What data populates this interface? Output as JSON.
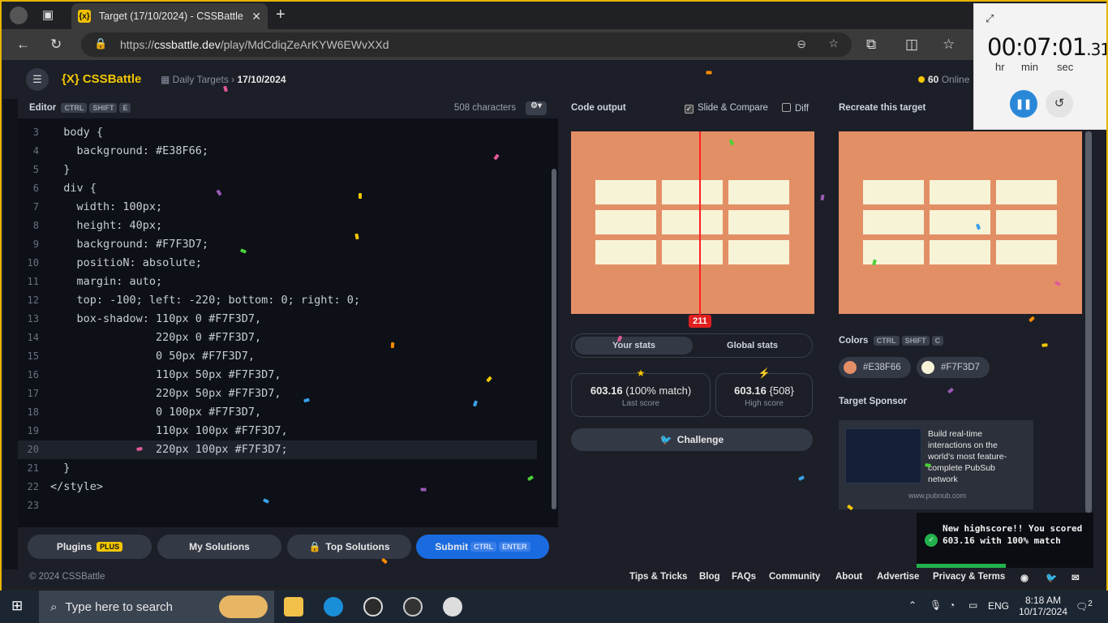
{
  "browser": {
    "tab_title": "Target (17/10/2024) - CSSBattle",
    "tab_favicon": "{x}",
    "url_prefix": "https://",
    "url_host": "cssbattle.dev",
    "url_path": "/play/MdCdiqZeArKYW6EWvXXd"
  },
  "header": {
    "logo": "{X} CSSBattle",
    "breadcrumb_parent": "Daily Targets",
    "breadcrumb_current": "17/10/2024",
    "online_count": "60",
    "online_label": "Online"
  },
  "editor": {
    "title": "Editor",
    "shortcut": [
      "CTRL",
      "SHIFT",
      "E"
    ],
    "char_count": "508 characters",
    "lines": [
      {
        "n": "3",
        "text": "  body {"
      },
      {
        "n": "4",
        "text": "    background: #E38F66;"
      },
      {
        "n": "5",
        "text": "  }"
      },
      {
        "n": "6",
        "text": "  div {"
      },
      {
        "n": "7",
        "text": "    width: 100px;"
      },
      {
        "n": "8",
        "text": "    height: 40px;"
      },
      {
        "n": "9",
        "text": "    background: #F7F3D7;"
      },
      {
        "n": "10",
        "text": "    positioN: absolute;"
      },
      {
        "n": "11",
        "text": "    margin: auto;"
      },
      {
        "n": "12",
        "text": "    top: -100; left: -220; bottom: 0; right: 0;"
      },
      {
        "n": "13",
        "text": "    box-shadow: 110px 0 #F7F3D7,"
      },
      {
        "n": "14",
        "text": "                220px 0 #F7F3D7,"
      },
      {
        "n": "15",
        "text": "                0 50px #F7F3D7,"
      },
      {
        "n": "16",
        "text": "                110px 50px #F7F3D7,"
      },
      {
        "n": "17",
        "text": "                220px 50px #F7F3D7,"
      },
      {
        "n": "18",
        "text": "                0 100px #F7F3D7,"
      },
      {
        "n": "19",
        "text": "                110px 100px #F7F3D7,"
      },
      {
        "n": "20",
        "text": "                220px 100px #F7F3D7;"
      },
      {
        "n": "21",
        "text": "  }"
      },
      {
        "n": "22",
        "text": "</style>"
      },
      {
        "n": "23",
        "text": ""
      }
    ],
    "buttons": {
      "plugins": "Plugins",
      "plugins_badge": "PLUS",
      "my_solutions": "My Solutions",
      "top_solutions": "Top Solutions",
      "submit": "Submit",
      "submit_kbd": [
        "CTRL",
        "ENTER"
      ]
    }
  },
  "output": {
    "title": "Code output",
    "slide_compare": "Slide & Compare",
    "diff": "Diff",
    "slider_value": "211",
    "tab_your": "Your stats",
    "tab_global": "Global stats",
    "last_score": "603.16",
    "last_match": "(100% match)",
    "last_label": "Last score",
    "high_score": "603.16",
    "high_chars": "{508}",
    "high_label": "High score",
    "challenge": "Challenge"
  },
  "target": {
    "title": "Recreate this target",
    "colors_title": "Colors",
    "colors_kbd": [
      "CTRL",
      "SHIFT",
      "C"
    ],
    "colors": [
      {
        "hex": "#E38F66",
        "label": "#E38F66"
      },
      {
        "hex": "#F7F3D7",
        "label": "#F7F3D7"
      }
    ],
    "sponsor_title": "Target Sponsor",
    "ad_text": "Build real-time interactions on the world's most feature-complete PubSub network",
    "ad_url": "www.pubnub.com"
  },
  "footer": {
    "copyright": "© 2024 CSSBattle",
    "links": [
      "Tips & Tricks",
      "Blog",
      "FAQs",
      "Community",
      "About",
      "Advertise",
      "Privacy & Terms"
    ]
  },
  "timer": {
    "time_main": "00:07:01",
    "time_frac": ".31",
    "hr": "hr",
    "min": "min",
    "sec": "sec"
  },
  "toast": {
    "message": "New highscore!! You scored 603.16 with 100% match"
  },
  "taskbar": {
    "search_placeholder": "Type here to search",
    "time": "8:18 AM",
    "date": "10/17/2024",
    "lang": "ENG",
    "notifications": "2"
  },
  "colors": {
    "bg_orange": "#E38F66",
    "cream": "#F7F3D7",
    "brand_yellow": "#F3C600",
    "submit_blue": "#1A6BE0"
  }
}
